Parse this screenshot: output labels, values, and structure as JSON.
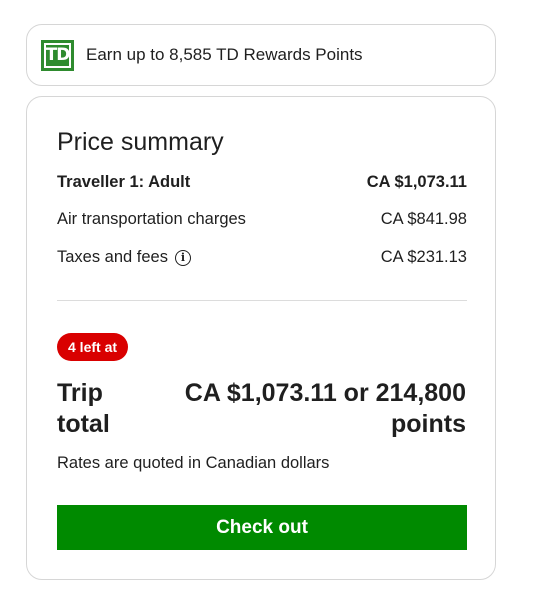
{
  "rewards": {
    "logo_text": "TD",
    "text": "Earn up to 8,585 TD Rewards Points"
  },
  "summary": {
    "title": "Price summary",
    "traveller": {
      "label": "Traveller 1: Adult",
      "value": "CA $1,073.11"
    },
    "air": {
      "label": "Air transportation charges",
      "value": "CA $841.98"
    },
    "taxes": {
      "label": "Taxes and fees",
      "value": "CA $231.13",
      "icon": "info-icon"
    },
    "badge": "4 left at",
    "total_label_line1": "Trip",
    "total_label_line2": "total",
    "total_value_line1": "CA $1,073.11 or 214,800",
    "total_value_line2": "points",
    "rates_note": "Rates are quoted in Canadian dollars",
    "checkout_label": "Check out"
  },
  "colors": {
    "brand_green": "#2e8b2e",
    "checkout_green": "#008a00",
    "badge_red": "#d90000"
  }
}
